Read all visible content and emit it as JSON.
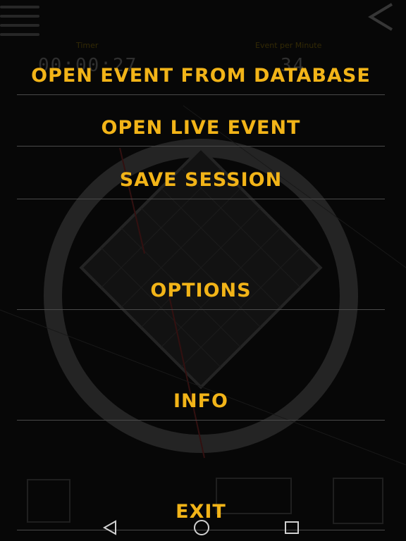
{
  "background": {
    "timer_label": "Timer",
    "timer_value": "00:00:27",
    "epm_label": "Event per Minute",
    "epm_value": "34"
  },
  "menu": {
    "items": [
      {
        "label": "OPEN EVENT FROM DATABASE"
      },
      {
        "label": "OPEN LIVE EVENT"
      },
      {
        "label": "SAVE SESSION"
      },
      {
        "label": "OPTIONS"
      },
      {
        "label": "INFO"
      },
      {
        "label": "EXIT"
      }
    ]
  },
  "colors": {
    "menu_text": "#f2b418",
    "divider": "#4a4a4a",
    "background": "#070707"
  },
  "nav": {
    "back": "triangle-back-icon",
    "home": "circle-home-icon",
    "recents": "square-recents-icon"
  }
}
